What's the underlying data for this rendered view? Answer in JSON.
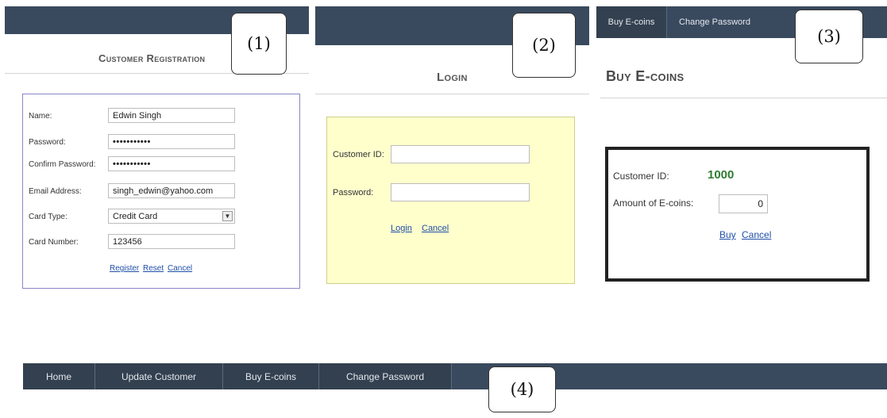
{
  "callouts": {
    "c1": "(1)",
    "c2": "(2)",
    "c3": "(3)",
    "c4": "(4)"
  },
  "registration": {
    "title": "Customer Registration",
    "fields": {
      "name": {
        "label": "Name:",
        "value": "Edwin Singh"
      },
      "password": {
        "label": "Password:",
        "value": "•••••••••••"
      },
      "confirm": {
        "label": "Confirm Password:",
        "value": "•••••••••••"
      },
      "email": {
        "label": "Email Address:",
        "value": "singh_edwin@yahoo.com"
      },
      "card_type": {
        "label": "Card Type:",
        "value": "Credit Card"
      },
      "card_number": {
        "label": "Card Number:",
        "value": "123456"
      }
    },
    "links": {
      "register": "Register",
      "reset": "Reset",
      "cancel": "Cancel"
    }
  },
  "login": {
    "title": "Login",
    "customer_id_label": "Customer ID:",
    "password_label": "Password:",
    "links": {
      "login": "Login",
      "cancel": "Cancel"
    }
  },
  "buy": {
    "nav": {
      "buy": "Buy E-coins",
      "change_password": "Change Password"
    },
    "title": "Buy E-coins",
    "customer_id_label": "Customer ID:",
    "customer_id_value": "1000",
    "amount_label": "Amount of E-coins:",
    "amount_value": "0",
    "links": {
      "buy": "Buy",
      "cancel": "Cancel"
    }
  },
  "menu": {
    "items": [
      "Home",
      "Update Customer",
      "Buy E-coins",
      "Change Password"
    ]
  },
  "colors": {
    "navbar": "#3a4a5e",
    "login_panel": "#ffffcc",
    "customer_id_value": "#2e7d32",
    "link": "#1f4fa8"
  }
}
